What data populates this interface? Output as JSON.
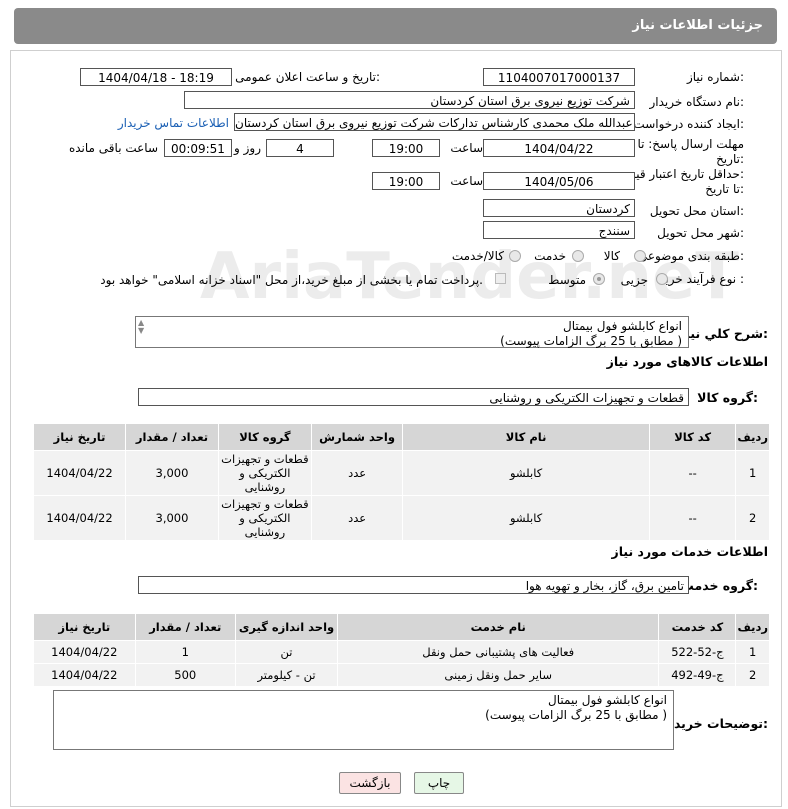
{
  "header": {
    "title": "جزئیات اطلاعات نیاز"
  },
  "watermark": {
    "text": "AriaTender.neT"
  },
  "form": {
    "need_number_label": "شماره نیاز:",
    "need_number": "1104007017000137",
    "announce_label": "تاریخ و ساعت اعلان عمومی:",
    "announce_value": "1404/04/18 - 18:19",
    "buyer_label": "نام دستگاه خریدار:",
    "buyer_value": "شرکت توزیع نیروی برق استان کردستان",
    "creator_label": "ایجاد کننده درخواست:",
    "creator_value": "عبدالله ملک محمدی کارشناس تدارکات شرکت توزیع نیروی برق استان کردستان",
    "contact_link": "اطلاعات تماس خریدار",
    "deadline_label_1": "مهلت ارسال پاسخ: تا",
    "deadline_label_2": "تاریخ:",
    "deadline_date": "1404/04/22",
    "time_label": "ساعت",
    "deadline_time": "19:00",
    "days_value": "4",
    "days_label": "روز و",
    "remaining_value": "00:09:51",
    "remaining_label": "ساعت باقی مانده",
    "validity_label_1": "حداقل تاریخ اعتبار قیمت:",
    "validity_label_2": "تا تاریخ:",
    "validity_date": "1404/05/06",
    "validity_time": "19:00",
    "province_label": "استان محل تحویل:",
    "province_value": "کردستان",
    "city_label": "شهر محل تحویل:",
    "city_value": "سنندج",
    "category_label": "طبقه بندی موضوعی:",
    "category_options": [
      "کالا",
      "خدمت",
      "کالا/خدمت"
    ],
    "category_selected": "کالا/خدمت",
    "process_label": "نوع فرآیند خرید :",
    "process_options": [
      "جزیی",
      "متوسط"
    ],
    "process_selected": "متوسط",
    "payment_note": "پرداخت تمام یا بخشی از مبلغ خرید،از محل \"اسناد خزانه اسلامی\" خواهد بود."
  },
  "summary": {
    "label": "شرح کلي نياز:",
    "line1": "انواع کابلشو فول بیمتال",
    "line2": "(مطابق با 25 برگ الزامات پیوست )"
  },
  "goods": {
    "section_title": "اطلاعات کالاهای مورد نیاز",
    "group_label": "گروه کالا:",
    "group_value": "قطعات و تجهیزات الکتریکی و روشنایی",
    "columns": [
      "ردیف",
      "کد کالا",
      "نام کالا",
      "واحد شمارش",
      "گروه کالا",
      "تعداد / مقدار",
      "تاریخ نیاز"
    ],
    "rows": [
      [
        "1",
        "--",
        "کابلشو",
        "عدد",
        "قطعات و تجهیزات الکتریکی و روشنایی",
        "3,000",
        "1404/04/22"
      ],
      [
        "2",
        "--",
        "کابلشو",
        "عدد",
        "قطعات و تجهیزات الکتریکی و روشنایی",
        "3,000",
        "1404/04/22"
      ]
    ]
  },
  "services": {
    "section_title": "اطلاعات خدمات مورد نیاز",
    "group_label": "گروه خدمت:",
    "group_value": "تامین برق، گاز، بخار و تهویه هوا",
    "columns": [
      "ردیف",
      "کد خدمت",
      "نام خدمت",
      "واحد اندازه گیری",
      "تعداد / مقدار",
      "تاریخ نیاز"
    ],
    "rows": [
      [
        "1",
        "ج-52-522",
        "فعالیت های پشتیبانی حمل ونقل",
        "تن",
        "1",
        "1404/04/22"
      ],
      [
        "2",
        "ج-49-492",
        "سایر حمل ونقل زمینی",
        "تن - کیلومتر",
        "500",
        "1404/04/22"
      ]
    ]
  },
  "buyer_notes": {
    "label": "توضیحات خریدار:",
    "line1": "انواع کابلشو فول بیمتال",
    "line2": "(مطابق با 25 برگ الزامات پیوست )"
  },
  "buttons": {
    "print": "چاپ",
    "back": "بازگشت"
  },
  "colors": {
    "header_bg": "#8a8a8a",
    "table_header": "#d6d6d6",
    "table_cell": "#f2f2f2",
    "link": "#1a5fb4",
    "back_btn": "#fbe3e3",
    "print_btn": "#e6f7e6"
  }
}
